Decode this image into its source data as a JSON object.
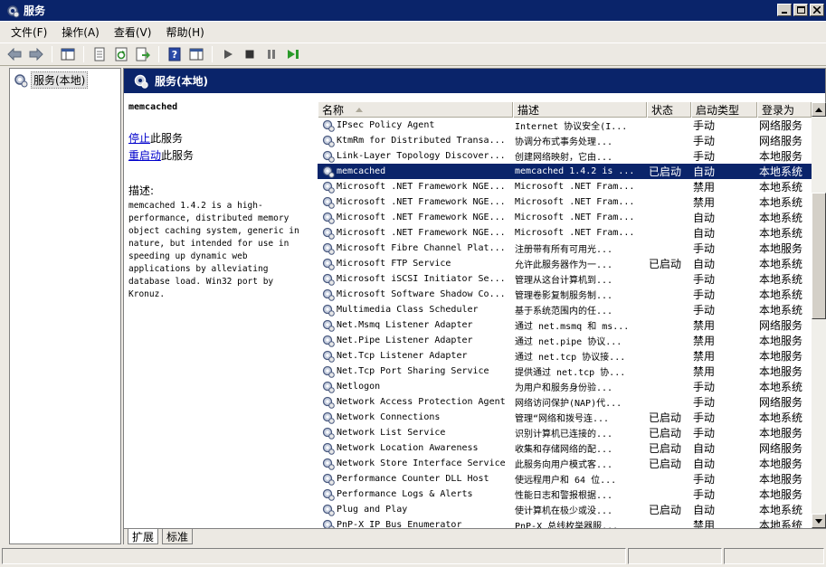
{
  "window": {
    "title": "服务"
  },
  "menu": [
    "文件(F)",
    "操作(A)",
    "查看(V)",
    "帮助(H)"
  ],
  "tree": {
    "root": "服务(本地)"
  },
  "right_header": {
    "title": "服务(本地)"
  },
  "details": {
    "service_name": "memcached",
    "stop_link": "停止",
    "stop_suffix": "此服务",
    "restart_link": "重启动",
    "restart_suffix": "此服务",
    "desc_label": "描述:",
    "desc_text": "memcached 1.4.2 is a high-performance, distributed memory object caching system, generic in nature, but intended for use in speeding up dynamic web applications by alleviating database load. Win32 port by Kronuz."
  },
  "columns": {
    "name": "名称",
    "desc": "描述",
    "status": "状态",
    "start": "启动类型",
    "logon": "登录为"
  },
  "services": [
    {
      "name": "IPsec Policy Agent",
      "desc": "Internet 协议安全(I...",
      "status": "",
      "start": "手动",
      "logon": "网络服务"
    },
    {
      "name": "KtmRm for Distributed Transa...",
      "desc": "协调分布式事务处理...",
      "status": "",
      "start": "手动",
      "logon": "网络服务"
    },
    {
      "name": "Link-Layer Topology Discover...",
      "desc": "创建网络映射，它由...",
      "status": "",
      "start": "手动",
      "logon": "本地服务"
    },
    {
      "name": "memcached",
      "desc": "memcached 1.4.2 is ...",
      "status": "已启动",
      "start": "自动",
      "logon": "本地系统",
      "selected": true
    },
    {
      "name": "Microsoft .NET Framework NGE...",
      "desc": "Microsoft .NET Fram...",
      "status": "",
      "start": "禁用",
      "logon": "本地系统"
    },
    {
      "name": "Microsoft .NET Framework NGE...",
      "desc": "Microsoft .NET Fram...",
      "status": "",
      "start": "禁用",
      "logon": "本地系统"
    },
    {
      "name": "Microsoft .NET Framework NGE...",
      "desc": "Microsoft .NET Fram...",
      "status": "",
      "start": "自动",
      "logon": "本地系统"
    },
    {
      "name": "Microsoft .NET Framework NGE...",
      "desc": "Microsoft .NET Fram...",
      "status": "",
      "start": "自动",
      "logon": "本地系统"
    },
    {
      "name": "Microsoft Fibre Channel Plat...",
      "desc": "注册带有所有可用光...",
      "status": "",
      "start": "手动",
      "logon": "本地服务"
    },
    {
      "name": "Microsoft FTP Service",
      "desc": "允许此服务器作为一...",
      "status": "已启动",
      "start": "自动",
      "logon": "本地系统"
    },
    {
      "name": "Microsoft iSCSI Initiator Se...",
      "desc": "管理从这台计算机到...",
      "status": "",
      "start": "手动",
      "logon": "本地系统"
    },
    {
      "name": "Microsoft Software Shadow Co...",
      "desc": "管理卷影复制服务制...",
      "status": "",
      "start": "手动",
      "logon": "本地系统"
    },
    {
      "name": "Multimedia Class Scheduler",
      "desc": "基于系统范围内的任...",
      "status": "",
      "start": "手动",
      "logon": "本地系统"
    },
    {
      "name": "Net.Msmq Listener Adapter",
      "desc": "通过 net.msmq 和 ms...",
      "status": "",
      "start": "禁用",
      "logon": "网络服务"
    },
    {
      "name": "Net.Pipe Listener Adapter",
      "desc": "通过 net.pipe 协议...",
      "status": "",
      "start": "禁用",
      "logon": "本地服务"
    },
    {
      "name": "Net.Tcp Listener Adapter",
      "desc": "通过 net.tcp 协议接...",
      "status": "",
      "start": "禁用",
      "logon": "本地服务"
    },
    {
      "name": "Net.Tcp Port Sharing Service",
      "desc": "提供通过 net.tcp 协...",
      "status": "",
      "start": "禁用",
      "logon": "本地服务"
    },
    {
      "name": "Netlogon",
      "desc": "为用户和服务身份验...",
      "status": "",
      "start": "手动",
      "logon": "本地系统"
    },
    {
      "name": "Network Access Protection Agent",
      "desc": "网络访问保护(NAP)代...",
      "status": "",
      "start": "手动",
      "logon": "网络服务"
    },
    {
      "name": "Network Connections",
      "desc": "管理“网络和拨号连...",
      "status": "已启动",
      "start": "手动",
      "logon": "本地系统"
    },
    {
      "name": "Network List Service",
      "desc": "识别计算机已连接的...",
      "status": "已启动",
      "start": "手动",
      "logon": "本地服务"
    },
    {
      "name": "Network Location Awareness",
      "desc": "收集和存储网络的配...",
      "status": "已启动",
      "start": "自动",
      "logon": "网络服务"
    },
    {
      "name": "Network Store Interface Service",
      "desc": "此服务向用户模式客...",
      "status": "已启动",
      "start": "自动",
      "logon": "本地服务"
    },
    {
      "name": "Performance Counter DLL Host",
      "desc": "使远程用户和 64 位...",
      "status": "",
      "start": "手动",
      "logon": "本地服务"
    },
    {
      "name": "Performance Logs & Alerts",
      "desc": "性能日志和警报根据...",
      "status": "",
      "start": "手动",
      "logon": "本地服务"
    },
    {
      "name": "Plug and Play",
      "desc": "使计算机在极少或没...",
      "status": "已启动",
      "start": "自动",
      "logon": "本地系统"
    },
    {
      "name": "PnP-X IP Bus Enumerator",
      "desc": "PnP-X 总线枚举器服...",
      "status": "",
      "start": "禁用",
      "logon": "本地系统"
    }
  ],
  "tabs": {
    "extended": "扩展",
    "standard": "标准"
  }
}
